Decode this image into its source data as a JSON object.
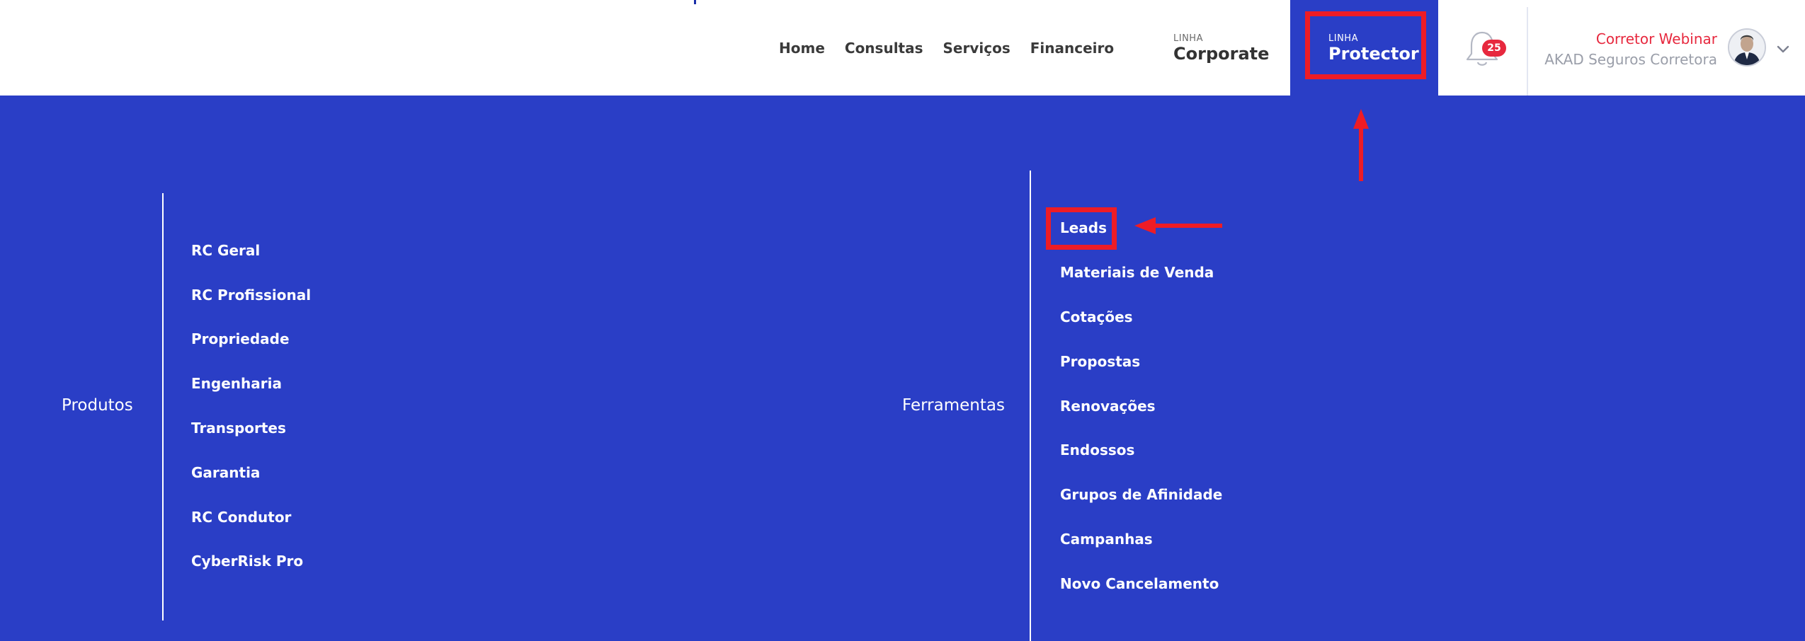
{
  "header": {
    "nav": [
      "Home",
      "Consultas",
      "Serviços",
      "Financeiro"
    ],
    "linha_corporate": {
      "small": "LINHA",
      "title": "Corporate"
    },
    "linha_protector": {
      "small": "LINHA",
      "title": "Protector"
    },
    "notifications": {
      "count": "25",
      "icon": "bell-icon"
    },
    "user": {
      "name": "Corretor Webinar",
      "company": "AKAD Seguros Corretora",
      "icon": "avatar"
    }
  },
  "menu": {
    "produtos": {
      "title": "Produtos",
      "items": [
        "RC Geral",
        "RC Profissional",
        "Propriedade",
        "Engenharia",
        "Transportes",
        "Garantia",
        "RC Condutor",
        "CyberRisk Pro"
      ]
    },
    "ferramentas": {
      "title": "Ferramentas",
      "items": [
        "Leads",
        "Materiais de Venda",
        "Cotações",
        "Propostas",
        "Renovações",
        "Endossos",
        "Grupos de Afinidade",
        "Campanhas",
        "Novo Cancelamento"
      ]
    }
  },
  "colors": {
    "primary": "#2a3ec6",
    "highlight": "#ee1c25",
    "accent_red": "#e7283e"
  }
}
